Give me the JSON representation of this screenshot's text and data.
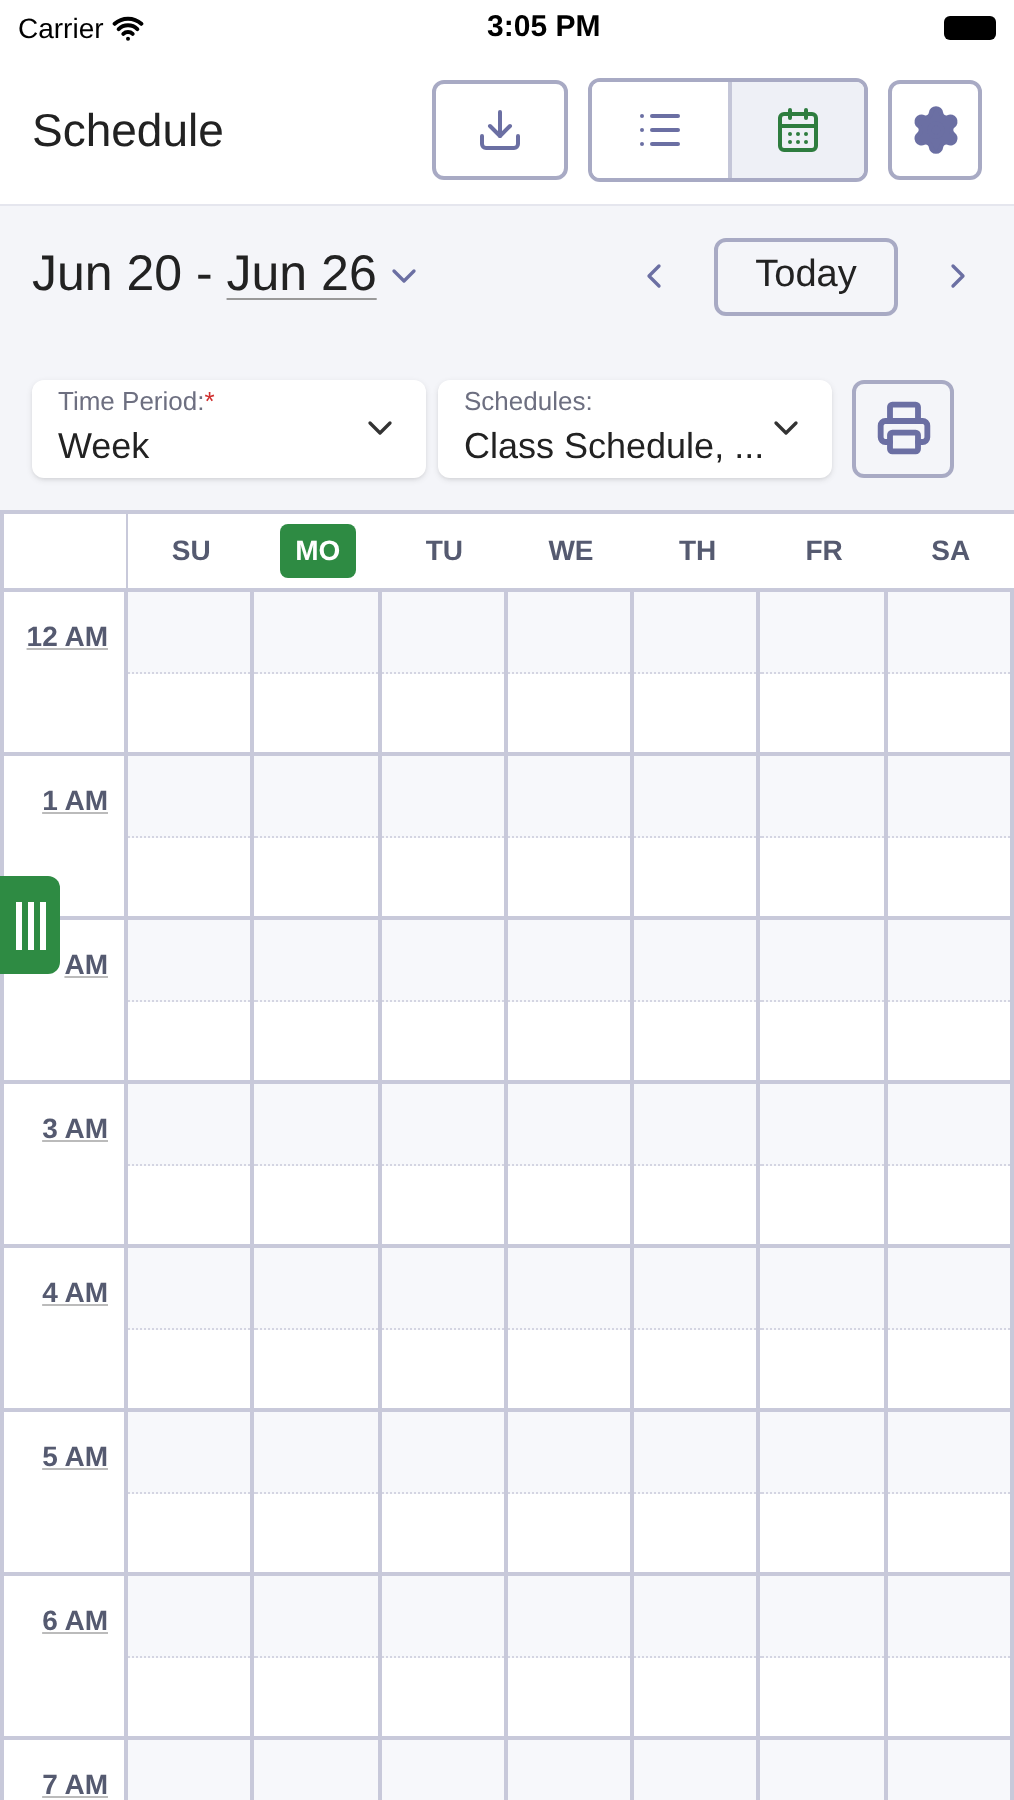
{
  "status_bar": {
    "carrier": "Carrier",
    "time": "3:05 PM"
  },
  "header": {
    "title": "Schedule",
    "views": [
      {
        "kind": "list",
        "selected": false
      },
      {
        "kind": "calendar",
        "selected": true
      }
    ]
  },
  "range": {
    "start": "Jun 20 - ",
    "end": "Jun 26",
    "today": "Today"
  },
  "filters": [
    {
      "label": "Time Period:",
      "required": true,
      "value": "Week"
    },
    {
      "label": "Schedules:",
      "required": false,
      "value": "Class Schedule, ..."
    }
  ],
  "required_mark": "*",
  "days": [
    {
      "label": "SU",
      "selected": false
    },
    {
      "label": "MO",
      "selected": true
    },
    {
      "label": "TU",
      "selected": false
    },
    {
      "label": "WE",
      "selected": false
    },
    {
      "label": "TH",
      "selected": false
    },
    {
      "label": "FR",
      "selected": false
    },
    {
      "label": "SA",
      "selected": false
    }
  ],
  "hours": [
    "12 AM",
    "1 AM",
    "AM",
    "3 AM",
    "4 AM",
    "5 AM",
    "6 AM",
    "7 AM"
  ]
}
